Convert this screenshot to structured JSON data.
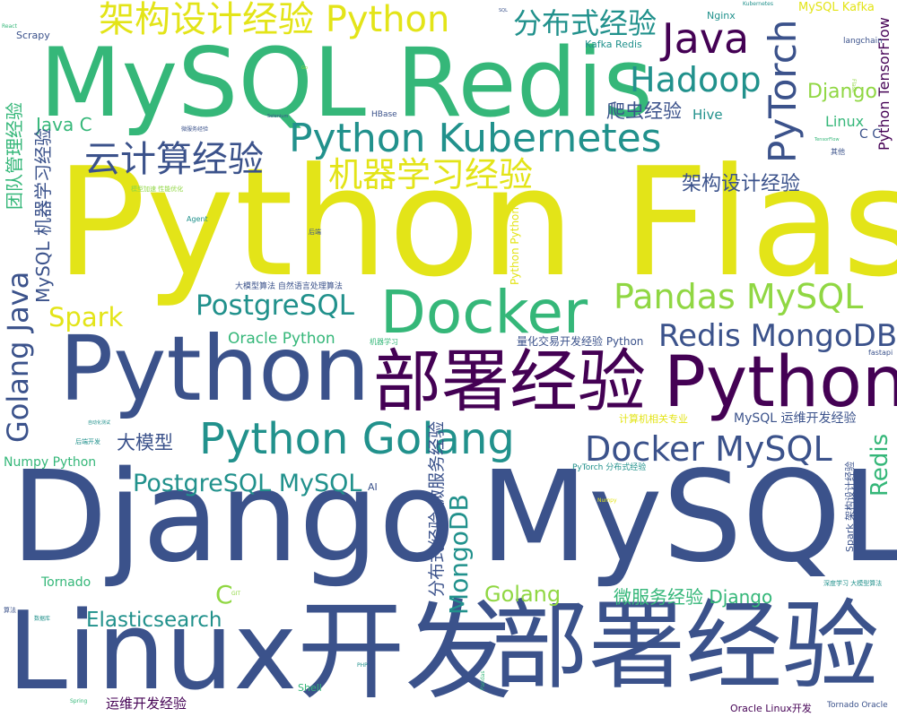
{
  "colors": {
    "purple": "#440154",
    "indigo": "#3b528b",
    "blue": "#31688e",
    "teal": "#21918c",
    "green": "#35b779",
    "lime": "#90d743",
    "yellow": "#e3e418"
  },
  "words": [
    {
      "id": "python-flask",
      "text": "Python Flask",
      "color": "yellow"
    },
    {
      "id": "mysql-redis",
      "text": "MySQL Redis",
      "color": "green"
    },
    {
      "id": "django",
      "text": "Django",
      "color": "indigo"
    },
    {
      "id": "mysql-big",
      "text": "MySQL",
      "color": "indigo"
    },
    {
      "id": "linux-dev",
      "text": "Linux开发",
      "color": "indigo"
    },
    {
      "id": "deploy-bottom",
      "text": "部署经验",
      "color": "indigo"
    },
    {
      "id": "python-big",
      "text": "Python",
      "color": "indigo"
    },
    {
      "id": "deploy-mid",
      "text": "部署经验",
      "color": "purple"
    },
    {
      "id": "python-right",
      "text": "Python",
      "color": "purple"
    },
    {
      "id": "docker",
      "text": "Docker",
      "color": "green"
    },
    {
      "id": "arch-python",
      "text": "架构设计经验 Python",
      "color": "yellow"
    },
    {
      "id": "python-kubernetes",
      "text": "Python Kubernetes",
      "color": "teal"
    },
    {
      "id": "python-golang",
      "text": "Python Golang",
      "color": "teal"
    },
    {
      "id": "java-top",
      "text": "Java",
      "color": "purple"
    },
    {
      "id": "pytorch",
      "text": "PyTorch",
      "color": "indigo"
    },
    {
      "id": "hadoop",
      "text": "Hadoop",
      "color": "teal"
    },
    {
      "id": "distributed",
      "text": "分布式经验",
      "color": "teal"
    },
    {
      "id": "cloud-exp",
      "text": "云计算经验",
      "color": "indigo"
    },
    {
      "id": "ml-exp",
      "text": "机器学习经验",
      "color": "yellow"
    },
    {
      "id": "pandas-mysql",
      "text": "Pandas MySQL",
      "color": "lime"
    },
    {
      "id": "postgresql",
      "text": "PostgreSQL",
      "color": "teal"
    },
    {
      "id": "redis-mongodb",
      "text": "Redis MongoDB",
      "color": "indigo"
    },
    {
      "id": "docker-mysql",
      "text": "Docker MySQL",
      "color": "indigo"
    },
    {
      "id": "postgresql-mysql",
      "text": "PostgreSQL MySQL",
      "color": "teal"
    },
    {
      "id": "golang-java",
      "text": "Golang Java",
      "color": "indigo"
    },
    {
      "id": "spark",
      "text": "Spark",
      "color": "yellow"
    },
    {
      "id": "elasticsearch",
      "text": "Elasticsearch",
      "color": "teal"
    },
    {
      "id": "golang",
      "text": "Golang",
      "color": "lime"
    },
    {
      "id": "microservice-django",
      "text": "微服务经验 Django",
      "color": "green"
    },
    {
      "id": "mongodb",
      "text": "MongoDB",
      "color": "teal"
    },
    {
      "id": "distributed-microservice",
      "text": "分布式经验 微服务经验",
      "color": "indigo"
    },
    {
      "id": "arch-exp",
      "text": "架构设计经验",
      "color": "indigo"
    },
    {
      "id": "crawler",
      "text": "爬虫经验",
      "color": "indigo"
    },
    {
      "id": "hive",
      "text": "Hive",
      "color": "teal"
    },
    {
      "id": "django-small",
      "text": "Django",
      "color": "lime"
    },
    {
      "id": "linux-small",
      "text": "Linux",
      "color": "green"
    },
    {
      "id": "c-c",
      "text": "C C",
      "color": "indigo"
    },
    {
      "id": "python-tensorflow",
      "text": "Python TensorFlow",
      "color": "purple"
    },
    {
      "id": "mysql-kafka",
      "text": "MySQL Kafka",
      "color": "yellow"
    },
    {
      "id": "kafka-redis",
      "text": "Kafka Redis",
      "color": "teal"
    },
    {
      "id": "nginx",
      "text": "Nginx",
      "color": "teal"
    },
    {
      "id": "langchain",
      "text": "langchain",
      "color": "indigo"
    },
    {
      "id": "team-management",
      "text": "团队管理经验",
      "color": "green"
    },
    {
      "id": "java-c",
      "text": "Java C",
      "color": "green"
    },
    {
      "id": "mysql-ml",
      "text": "MySQL 机器学习经验",
      "color": "indigo"
    },
    {
      "id": "scrapy",
      "text": "Scrapy",
      "color": "indigo"
    },
    {
      "id": "oracle-python",
      "text": "Oracle Python",
      "color": "green"
    },
    {
      "id": "big-model",
      "text": "大模型",
      "color": "indigo"
    },
    {
      "id": "numpy-python",
      "text": "Numpy Python",
      "color": "green"
    },
    {
      "id": "tornado",
      "text": "Tornado",
      "color": "green"
    },
    {
      "id": "c-single",
      "text": "C",
      "color": "lime"
    },
    {
      "id": "redis-right",
      "text": "Redis",
      "color": "green"
    },
    {
      "id": "quant-python",
      "text": "量化交易开发经验 Python",
      "color": "indigo"
    },
    {
      "id": "cs-major",
      "text": "计算机相关专业",
      "color": "yellow"
    },
    {
      "id": "mysql-ops",
      "text": "MySQL 运维开发经验",
      "color": "indigo"
    },
    {
      "id": "ops-dev",
      "text": "运维开发经验",
      "color": "purple"
    },
    {
      "id": "oracle-linux",
      "text": "Oracle Linux开发",
      "color": "purple"
    },
    {
      "id": "tornado-oracle",
      "text": "Tornado Oracle",
      "color": "indigo"
    },
    {
      "id": "pytorch-distributed",
      "text": "PyTorch 分布式经验",
      "color": "teal"
    },
    {
      "id": "spark-arch",
      "text": "Spark 架构设计经验",
      "color": "indigo"
    },
    {
      "id": "deep-learning-model",
      "text": "深度学习 大模型算法",
      "color": "teal"
    },
    {
      "id": "python-python-v",
      "text": "Python Python",
      "color": "yellow"
    },
    {
      "id": "ai",
      "text": "AI",
      "color": "indigo"
    },
    {
      "id": "fastapi",
      "text": "fastapi",
      "color": "indigo"
    },
    {
      "id": "shell",
      "text": "Shell",
      "color": "green"
    },
    {
      "id": "big-model-nlp",
      "text": "大模型算法 自然语言处理算法",
      "color": "indigo"
    },
    {
      "id": "ml-small",
      "text": "机器学习",
      "color": "green"
    },
    {
      "id": "hbase",
      "text": "HBase",
      "color": "indigo"
    },
    {
      "id": "agent",
      "text": "Agent",
      "color": "teal"
    },
    {
      "id": "backend",
      "text": "后端",
      "color": "indigo"
    },
    {
      "id": "microservice-small",
      "text": "微服务经验",
      "color": "indigo"
    },
    {
      "id": "other",
      "text": "其他",
      "color": "indigo"
    },
    {
      "id": "backend-dev",
      "text": "后端开发",
      "color": "teal"
    },
    {
      "id": "auto-test",
      "text": "自动化测试",
      "color": "teal"
    },
    {
      "id": "kubernetes-small",
      "text": "Kubernetes",
      "color": "teal"
    },
    {
      "id": "react",
      "text": "React",
      "color": "green"
    },
    {
      "id": "selenium",
      "text": "Selenium",
      "color": "indigo"
    },
    {
      "id": "api",
      "text": "API",
      "color": "indigo"
    },
    {
      "id": "php",
      "text": "PHP",
      "color": "teal"
    },
    {
      "id": "spring",
      "text": "Spring",
      "color": "green"
    },
    {
      "id": "pandas-v",
      "text": "Pandas",
      "color": "green"
    },
    {
      "id": "algorithm",
      "text": "算法",
      "color": "indigo"
    },
    {
      "id": "database",
      "text": "数据库",
      "color": "teal"
    },
    {
      "id": "model-accel",
      "text": "模型加速 性能优化",
      "color": "lime"
    },
    {
      "id": "flask-v",
      "text": "Flask",
      "color": "lime"
    },
    {
      "id": "tensorflow-small",
      "text": "TensorFlow",
      "color": "green"
    },
    {
      "id": "sql-tiny",
      "text": "SQL",
      "color": "indigo"
    },
    {
      "id": "numpy-tiny",
      "text": "Numpy",
      "color": "yellow"
    },
    {
      "id": "go-tiny",
      "text": "Go",
      "color": "lime"
    },
    {
      "id": "git-tiny",
      "text": "GIT",
      "color": "lime"
    }
  ]
}
